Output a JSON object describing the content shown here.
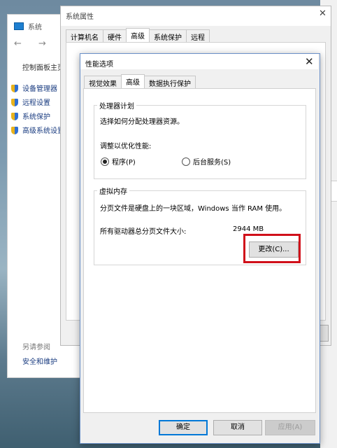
{
  "system_window": {
    "title": "系统",
    "nav_arrows": "← → ↑",
    "control_panel_home": "控制面板主页",
    "links": [
      "设备管理器",
      "远程设置",
      "系统保护",
      "高级系统设置"
    ],
    "see_also": "另请参阅",
    "security": "安全和维护"
  },
  "system_properties": {
    "title": "系统属性",
    "tabs": [
      "计算机名",
      "硬件",
      "高级",
      "系统保护",
      "远程"
    ],
    "active_tab": "高级"
  },
  "performance_options": {
    "title": "性能选项",
    "tabs": [
      "视觉效果",
      "高级",
      "数据执行保护"
    ],
    "active_tab": "高级",
    "processor_group": {
      "title": "处理器计划",
      "desc": "选择如何分配处理器资源。",
      "adjust_label": "调整以优化性能:",
      "option_programs": "程序(P)",
      "option_services": "后台服务(S)",
      "selected": "程序(P)"
    },
    "virtual_memory_group": {
      "title": "虚拟内存",
      "desc": "分页文件是硬盘上的一块区域，Windows 当作 RAM 使用。",
      "total_label": "所有驱动器总分页文件大小:",
      "total_value": "2944 MB",
      "change_button": "更改(C)..."
    },
    "buttons": {
      "ok": "确定",
      "cancel": "取消",
      "apply": "应用(A)"
    }
  },
  "colors": {
    "highlight_border": "#d0101a",
    "primary_button_border": "#0078d7"
  }
}
